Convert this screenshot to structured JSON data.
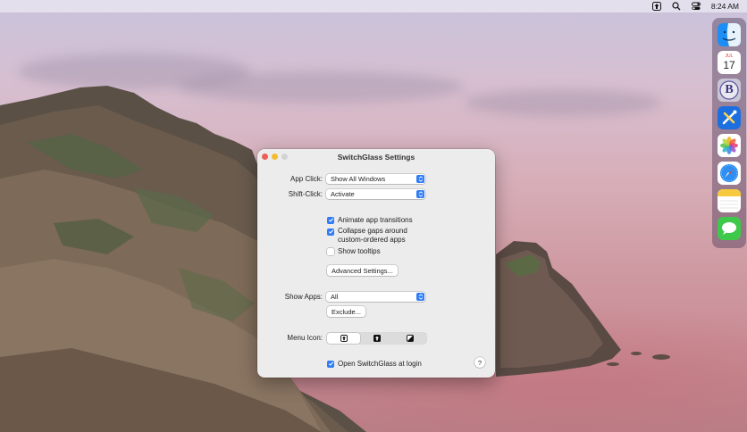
{
  "menubar": {
    "items": [
      {
        "icon": "switchglass-menu-icon"
      },
      {
        "icon": "search-icon"
      },
      {
        "icon": "control-center-icon"
      }
    ],
    "clock": "8:24 AM"
  },
  "dock": {
    "apps": [
      {
        "name": "finder",
        "icon": "finder-icon"
      },
      {
        "name": "calendar",
        "icon": "calendar-icon",
        "month": "JUL",
        "day": "17"
      },
      {
        "name": "bbedit",
        "icon": "bbedit-icon",
        "letter": "B"
      },
      {
        "name": "xcode",
        "icon": "xcode-icon"
      },
      {
        "name": "photos",
        "icon": "photos-icon"
      },
      {
        "name": "safari",
        "icon": "safari-icon"
      },
      {
        "name": "notes",
        "icon": "notes-icon"
      },
      {
        "name": "messages",
        "icon": "messages-icon"
      }
    ]
  },
  "window": {
    "title": "SwitchGlass Settings",
    "app_click": {
      "label": "App Click:",
      "value": "Show All Windows"
    },
    "shift_click": {
      "label": "Shift-Click:",
      "value": "Activate"
    },
    "checkboxes": [
      {
        "label": "Animate app transitions",
        "checked": true
      },
      {
        "label": "Collapse gaps around",
        "label2": "custom-ordered apps",
        "checked": true
      },
      {
        "label": "Show tooltips",
        "checked": false
      }
    ],
    "advanced_button": "Advanced Settings...",
    "show_apps": {
      "label": "Show Apps:",
      "value": "All"
    },
    "exclude_button": "Exclude...",
    "menu_icon": {
      "label": "Menu Icon:",
      "selected_index": 0,
      "options": [
        "outline-arrow-icon",
        "filled-arrow-icon",
        "half-square-icon"
      ]
    },
    "login_checkbox": {
      "label": "Open SwitchGlass at login",
      "checked": true
    },
    "help_label": "?"
  },
  "colors": {
    "accent": "#2f7cf6",
    "close": "#ee5e57",
    "minimize": "#f4bc2f"
  }
}
